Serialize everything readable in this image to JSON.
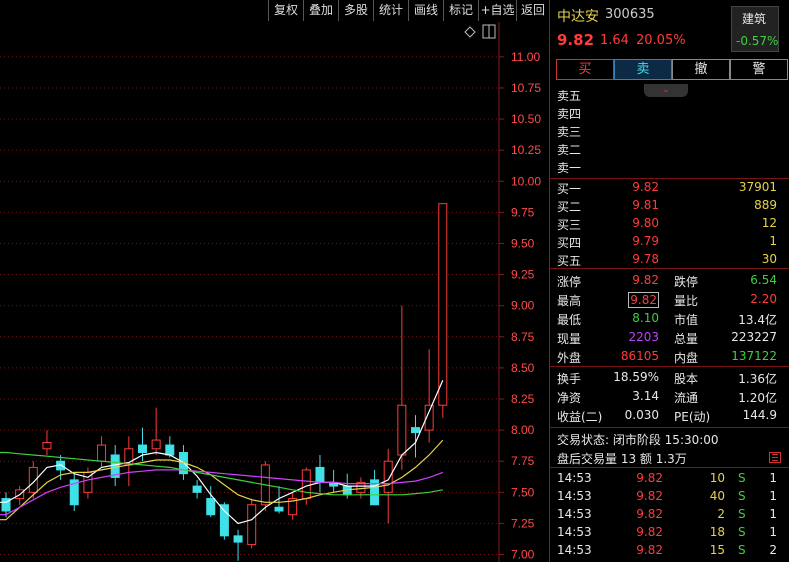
{
  "toolbar": [
    "复权",
    "叠加",
    "多股",
    "统计",
    "画线",
    "标记",
    "+自选",
    "返回"
  ],
  "chart_data": {
    "type": "candlestick",
    "y_ticks": [
      "11.00",
      "10.75",
      "10.50",
      "10.25",
      "10.00",
      "9.75",
      "9.50",
      "9.25",
      "9.00",
      "8.75",
      "8.50",
      "8.25",
      "8.00",
      "7.75",
      "7.50",
      "7.25",
      "7.00"
    ],
    "ylim": [
      6.94,
      11.28
    ],
    "candles": [
      {
        "o": 7.45,
        "h": 7.5,
        "l": 7.3,
        "c": 7.35
      },
      {
        "o": 7.45,
        "h": 7.55,
        "l": 7.4,
        "c": 7.52
      },
      {
        "o": 7.5,
        "h": 7.75,
        "l": 7.45,
        "c": 7.7
      },
      {
        "o": 7.85,
        "h": 8.0,
        "l": 7.8,
        "c": 7.9
      },
      {
        "o": 7.75,
        "h": 7.8,
        "l": 7.6,
        "c": 7.68
      },
      {
        "o": 7.6,
        "h": 7.65,
        "l": 7.35,
        "c": 7.4
      },
      {
        "o": 7.5,
        "h": 7.7,
        "l": 7.45,
        "c": 7.66
      },
      {
        "o": 7.75,
        "h": 7.95,
        "l": 7.7,
        "c": 7.88
      },
      {
        "o": 7.8,
        "h": 7.88,
        "l": 7.55,
        "c": 7.62
      },
      {
        "o": 7.72,
        "h": 7.95,
        "l": 7.55,
        "c": 7.85
      },
      {
        "o": 7.88,
        "h": 8.02,
        "l": 7.75,
        "c": 7.82
      },
      {
        "o": 7.85,
        "h": 8.18,
        "l": 7.8,
        "c": 7.92
      },
      {
        "o": 7.88,
        "h": 7.95,
        "l": 7.78,
        "c": 7.8
      },
      {
        "o": 7.82,
        "h": 7.88,
        "l": 7.6,
        "c": 7.65
      },
      {
        "o": 7.55,
        "h": 7.6,
        "l": 7.45,
        "c": 7.5
      },
      {
        "o": 7.45,
        "h": 7.55,
        "l": 7.3,
        "c": 7.32
      },
      {
        "o": 7.4,
        "h": 7.42,
        "l": 7.12,
        "c": 7.15
      },
      {
        "o": 7.15,
        "h": 7.2,
        "l": 6.95,
        "c": 7.1
      },
      {
        "o": 7.08,
        "h": 7.45,
        "l": 7.05,
        "c": 7.4
      },
      {
        "o": 7.4,
        "h": 7.75,
        "l": 7.35,
        "c": 7.72
      },
      {
        "o": 7.38,
        "h": 7.55,
        "l": 7.33,
        "c": 7.35
      },
      {
        "o": 7.32,
        "h": 7.5,
        "l": 7.28,
        "c": 7.45
      },
      {
        "o": 7.45,
        "h": 7.7,
        "l": 7.4,
        "c": 7.68
      },
      {
        "o": 7.7,
        "h": 7.8,
        "l": 7.5,
        "c": 7.58
      },
      {
        "o": 7.58,
        "h": 7.68,
        "l": 7.5,
        "c": 7.55
      },
      {
        "o": 7.55,
        "h": 7.65,
        "l": 7.45,
        "c": 7.48
      },
      {
        "o": 7.5,
        "h": 7.62,
        "l": 7.45,
        "c": 7.58
      },
      {
        "o": 7.6,
        "h": 7.68,
        "l": 7.5,
        "c": 7.4
      },
      {
        "o": 7.5,
        "h": 7.85,
        "l": 7.25,
        "c": 7.75
      },
      {
        "o": 7.8,
        "h": 9.0,
        "l": 7.68,
        "c": 8.2
      },
      {
        "o": 8.02,
        "h": 8.12,
        "l": 7.78,
        "c": 7.98
      },
      {
        "o": 8.0,
        "h": 8.65,
        "l": 7.9,
        "c": 8.2
      },
      {
        "o": 8.2,
        "h": 9.82,
        "l": 8.1,
        "c": 9.82
      }
    ],
    "ma_lines": [
      {
        "color": "#ffffff",
        "values": [
          7.42,
          7.48,
          7.58,
          7.7,
          7.72,
          7.65,
          7.62,
          7.7,
          7.72,
          7.74,
          7.8,
          7.82,
          7.8,
          7.74,
          7.63,
          7.48,
          7.35,
          7.25,
          7.28,
          7.38,
          7.45,
          7.5,
          7.55,
          7.58,
          7.58,
          7.55,
          7.55,
          7.55,
          7.6,
          7.8,
          7.9,
          8.15,
          8.4
        ]
      },
      {
        "color": "#e6d34b",
        "values": [
          7.28,
          7.38,
          7.48,
          7.58,
          7.64,
          7.66,
          7.66,
          7.68,
          7.7,
          7.72,
          7.74,
          7.76,
          7.76,
          7.74,
          7.7,
          7.64,
          7.56,
          7.48,
          7.44,
          7.42,
          7.42,
          7.43,
          7.45,
          7.48,
          7.5,
          7.52,
          7.53,
          7.54,
          7.56,
          7.62,
          7.7,
          7.8,
          7.92
        ]
      },
      {
        "color": "#d040ff",
        "values": [
          7.32,
          7.38,
          7.44,
          7.5,
          7.54,
          7.57,
          7.6,
          7.62,
          7.64,
          7.66,
          7.67,
          7.68,
          7.68,
          7.68,
          7.67,
          7.66,
          7.65,
          7.64,
          7.63,
          7.62,
          7.61,
          7.6,
          7.59,
          7.58,
          7.58,
          7.57,
          7.57,
          7.57,
          7.57,
          7.58,
          7.59,
          7.62,
          7.66
        ]
      },
      {
        "color": "#3ecf3e",
        "values": [
          7.82,
          7.81,
          7.8,
          7.79,
          7.78,
          7.77,
          7.76,
          7.75,
          7.74,
          7.73,
          7.72,
          7.71,
          7.7,
          7.68,
          7.66,
          7.64,
          7.62,
          7.6,
          7.58,
          7.56,
          7.54,
          7.52,
          7.5,
          7.49,
          7.48,
          7.48,
          7.48,
          7.48,
          7.48,
          7.48,
          7.49,
          7.5,
          7.52
        ]
      }
    ]
  },
  "quote": {
    "name": "中达安",
    "code": "300635",
    "price": "9.82",
    "change": "1.64",
    "change_pct": "20.05%",
    "sector": "建筑",
    "sector_pct": "-0.57%"
  },
  "trade_buttons": [
    "买",
    "卖",
    "撤",
    "警"
  ],
  "sell_levels": [
    {
      "label": "卖五",
      "price": "",
      "vol": ""
    },
    {
      "label": "卖四",
      "price": "",
      "vol": ""
    },
    {
      "label": "卖三",
      "price": "",
      "vol": ""
    },
    {
      "label": "卖二",
      "price": "",
      "vol": ""
    },
    {
      "label": "卖一",
      "price": "",
      "vol": ""
    }
  ],
  "buy_levels": [
    {
      "label": "买一",
      "price": "9.82",
      "vol": "37901"
    },
    {
      "label": "买二",
      "price": "9.81",
      "vol": "889"
    },
    {
      "label": "买三",
      "price": "9.80",
      "vol": "12"
    },
    {
      "label": "买四",
      "price": "9.79",
      "vol": "1"
    },
    {
      "label": "买五",
      "price": "9.78",
      "vol": "30"
    }
  ],
  "stats": [
    {
      "l1": "涨停",
      "v1": "9.82",
      "l2": "跌停",
      "v2": "6.54"
    },
    {
      "l1": "最高",
      "v1": "9.82",
      "l2": "量比",
      "v2": "2.20"
    },
    {
      "l1": "最低",
      "v1": "8.10",
      "l2": "市值",
      "v2": "13.4亿"
    },
    {
      "l1": "现量",
      "v1": "2203",
      "l2": "总量",
      "v2": "223227"
    },
    {
      "l1": "外盘",
      "v1": "86105",
      "l2": "内盘",
      "v2": "137122"
    }
  ],
  "fundamentals": [
    {
      "l1": "换手",
      "v1": "18.59%",
      "l2": "股本",
      "v2": "1.36亿"
    },
    {
      "l1": "净资",
      "v1": "3.14",
      "l2": "流通",
      "v2": "1.20亿"
    },
    {
      "l1": "收益(二)",
      "v1": "0.030",
      "l2": "PE(动)",
      "v2": "144.9"
    }
  ],
  "status": {
    "state": "交易状态: 闭市阶段 15:30:00",
    "after_hours": "盘后交易量 13 额 1.3万"
  },
  "ticks": [
    {
      "time": "14:53",
      "price": "9.82",
      "vol": "10",
      "side": "S",
      "n": "1"
    },
    {
      "time": "14:53",
      "price": "9.82",
      "vol": "40",
      "side": "S",
      "n": "1"
    },
    {
      "time": "14:53",
      "price": "9.82",
      "vol": "2",
      "side": "S",
      "n": "1"
    },
    {
      "time": "14:53",
      "price": "9.82",
      "vol": "18",
      "side": "S",
      "n": "1"
    },
    {
      "time": "14:53",
      "price": "9.82",
      "vol": "15",
      "side": "S",
      "n": "2"
    }
  ]
}
